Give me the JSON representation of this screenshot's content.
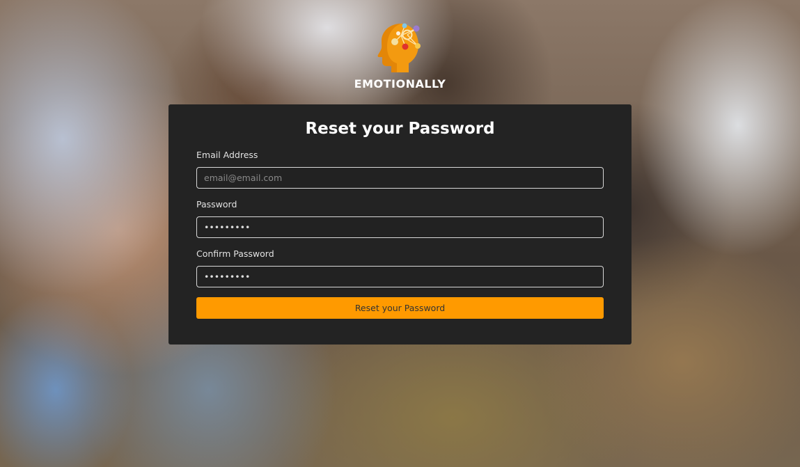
{
  "brand": {
    "name": "EMOTIONALLY",
    "icon": "head-emotions-icon",
    "accent": "#ff9a00"
  },
  "form": {
    "title": "Reset your Password",
    "email": {
      "label": "Email Address",
      "placeholder": "email@email.com",
      "value": ""
    },
    "password": {
      "label": "Password",
      "value": "•••••••••"
    },
    "confirm_password": {
      "label": "Confirm Password",
      "value": "•••••••••"
    },
    "submit_label": "Reset your Password"
  },
  "colors": {
    "card_background": "#232323",
    "button": "#ff9a00",
    "text": "#ffffff"
  }
}
